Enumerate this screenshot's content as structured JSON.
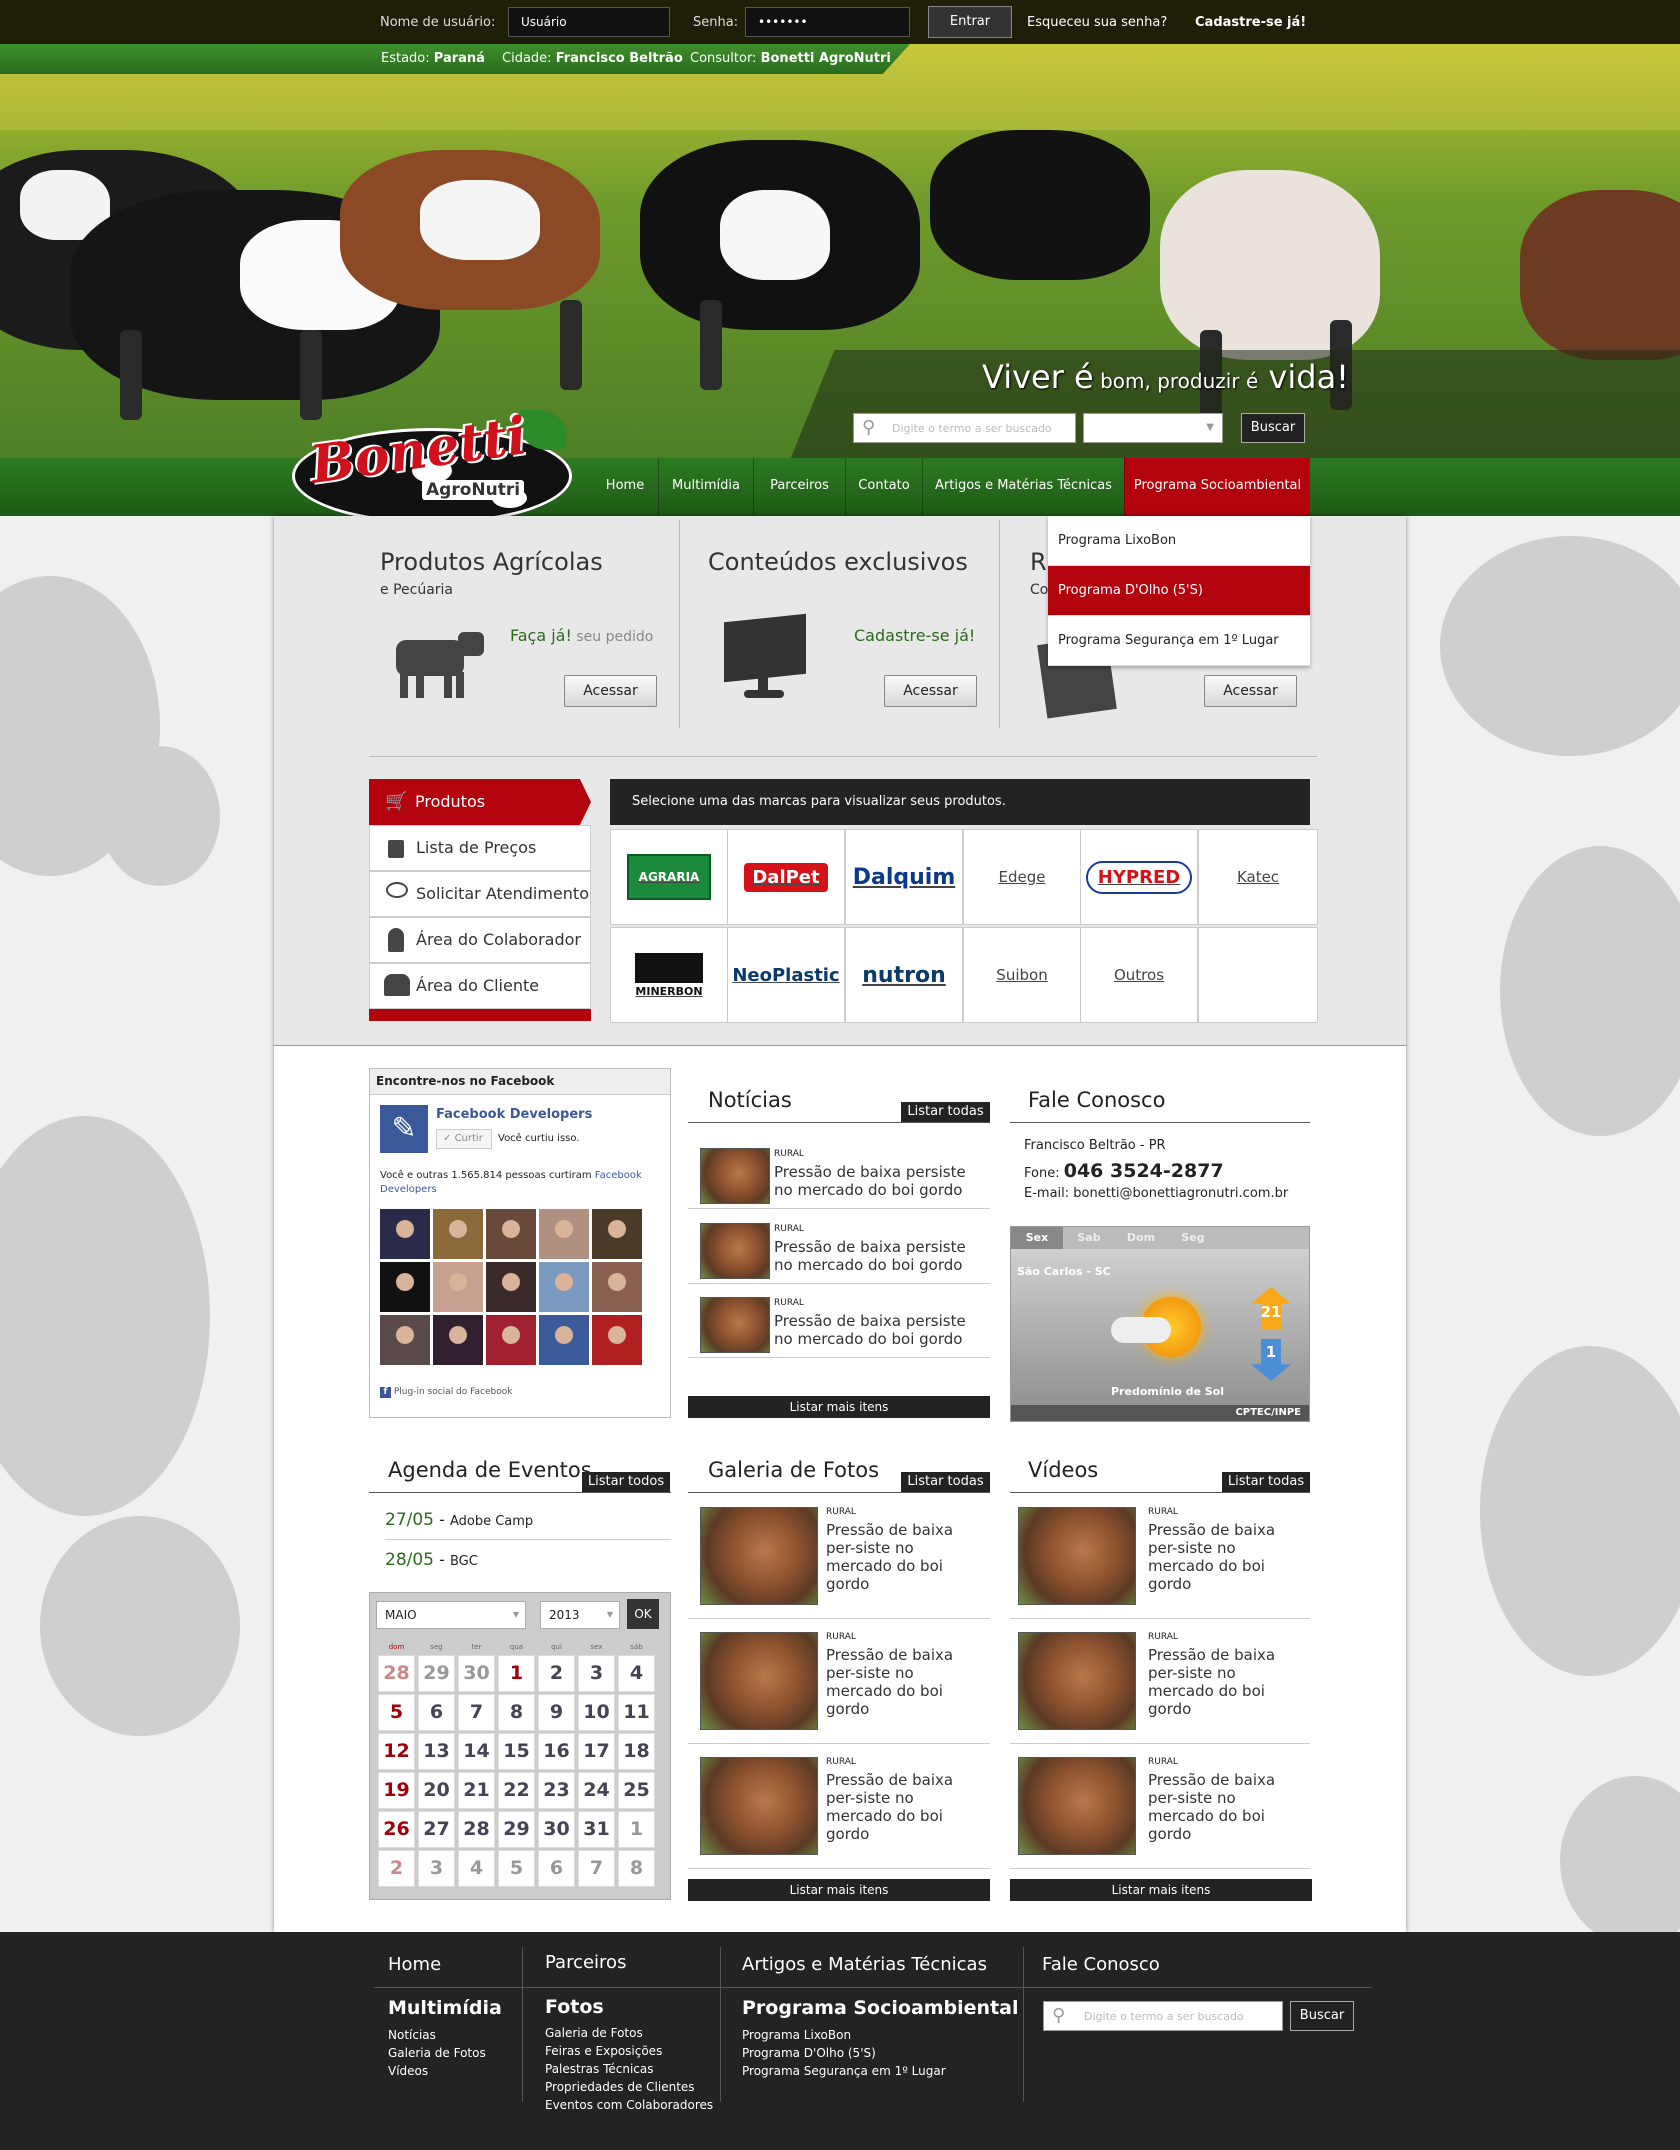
{
  "login": {
    "user_label": "Nome de usuário:",
    "user_value": "Usuário",
    "pass_label": "Senha:",
    "pass_value": "•••••••",
    "enter": "Entrar",
    "forgot": "Esqueceu sua senha?",
    "signup": "Cadastre-se já!"
  },
  "location": {
    "state_label": "Estado:",
    "state": "Paraná",
    "city_label": "Cidade:",
    "city": "Francisco Beltrão",
    "consultant_label": "Consultor:",
    "consultant": "Bonetti AgroNutri"
  },
  "hero": {
    "slogan_a": "Viver ",
    "slogan_b": "é",
    "slogan_c": " bom, produzir ",
    "slogan_d": "é",
    "slogan_e": " vida!",
    "search_placeholder": "Digite o termo a ser buscado",
    "search_button": "Buscar"
  },
  "logo": {
    "name": "Bonetti",
    "sub": "AgroNutri"
  },
  "nav": {
    "items": [
      "Home",
      "Multimídia",
      "Parceiros",
      "Contato",
      "Artigos e Matérias Técnicas",
      "Programa Socioambiental"
    ]
  },
  "dropdown": [
    "Programa LixoBon",
    "Programa D'Olho (5'S)",
    "Programa Segurança em 1º Lugar"
  ],
  "features": [
    {
      "title": "Produtos Agrícolas",
      "sub": "e Pecúaria",
      "cta": "Faça já!",
      "cta2": " seu pedido",
      "button": "Acessar"
    },
    {
      "title": "Conteúdos exclusivos",
      "cta": "Cadastre-se já!",
      "button": "Acessar"
    },
    {
      "title": "R",
      "sub": "Co",
      "button": "Acessar"
    }
  ],
  "side_menu": {
    "items": [
      "Produtos",
      "Lista de Preços",
      "Solicitar Atendimento",
      "Área do Colaborador",
      "Área do Cliente"
    ]
  },
  "brands": {
    "header": "Selecione uma das marcas para visualizar seus produtos.",
    "row1": [
      "AGRARIA",
      "DalPet",
      "Dalquim",
      "Edege",
      "HYPRED",
      "Katec"
    ],
    "row2": [
      "MINERBON",
      "NeoPlastic",
      "nutron",
      "Suibon",
      "Outros",
      ""
    ]
  },
  "facebook": {
    "header": "Encontre-nos no Facebook",
    "page": "Facebook Developers",
    "like": "Curtir",
    "liked": "Você curtiu isso.",
    "count_text": "Você e outras 1.565.814 pessoas curtiram ",
    "count_link": "Facebook Developers",
    "plugin": "Plug-in social do Facebook"
  },
  "news": {
    "title": "Notícias",
    "list_all": "Listar todas",
    "items": [
      {
        "tag": "RURAL",
        "text": "Pressão de baixa persiste no mercado do boi gordo"
      },
      {
        "tag": "RURAL",
        "text": "Pressão de baixa persiste no mercado do boi gordo"
      },
      {
        "tag": "RURAL",
        "text": "Pressão de baixa persiste no mercado do boi gordo"
      }
    ],
    "more": "Listar mais itens"
  },
  "contact": {
    "title": "Fale Conosco",
    "city": "Francisco Beltrão - PR",
    "phone_label": "Fone:",
    "phone": "046 3524-2877",
    "email_label": "E-mail:",
    "email": "bonetti@bonettiagronutri.com.br"
  },
  "weather": {
    "days": [
      "Sex",
      "Sab",
      "Dom",
      "Seg"
    ],
    "place": "São Carlos - SC",
    "max": "21",
    "min": "1",
    "desc": "Predomínio de Sol",
    "source": "CPTEC/INPE"
  },
  "events": {
    "title": "Agenda de Eventos",
    "list_all": "Listar todos",
    "items": [
      {
        "date": "27/05",
        "name": "Adobe Camp"
      },
      {
        "date": "28/05",
        "name": "BGC"
      }
    ]
  },
  "calendar": {
    "month": "MAIO",
    "year": "2013",
    "ok": "OK",
    "weekdays": [
      "dom",
      "seg",
      "ter",
      "qua",
      "qui",
      "sex",
      "sáb"
    ],
    "days": [
      "28",
      "29",
      "30",
      "1",
      "2",
      "3",
      "4",
      "5",
      "6",
      "7",
      "8",
      "9",
      "10",
      "11",
      "12",
      "13",
      "14",
      "15",
      "16",
      "17",
      "18",
      "19",
      "20",
      "21",
      "22",
      "23",
      "24",
      "25",
      "26",
      "27",
      "28",
      "29",
      "30",
      "31",
      "1",
      "2",
      "3",
      "4",
      "5",
      "6",
      "7",
      "8"
    ]
  },
  "gallery": {
    "title": "Galeria de Fotos",
    "list_all": "Listar todas",
    "items": [
      {
        "tag": "RURAL",
        "text": "Pressão de baixa per-siste no mercado do boi gordo"
      },
      {
        "tag": "RURAL",
        "text": "Pressão de baixa per-siste no mercado do boi gordo"
      },
      {
        "tag": "RURAL",
        "text": "Pressão de baixa per-siste no mercado do boi gordo"
      }
    ],
    "more": "Listar mais itens"
  },
  "videos": {
    "title": "Vídeos",
    "list_all": "Listar todas",
    "items": [
      {
        "tag": "RURAL",
        "text": "Pressão de baixa per-siste no mercado do boi gordo"
      },
      {
        "tag": "RURAL",
        "text": "Pressão de baixa per-siste no mercado do boi gordo"
      },
      {
        "tag": "RURAL",
        "text": "Pressão de baixa per-siste no mercado do boi gordo"
      }
    ],
    "more": "Listar mais itens"
  },
  "footer": {
    "home": "Home",
    "parceiros": "Parceiros",
    "artigos": "Artigos e Matérias Técnicas",
    "fale": "Fale Conosco",
    "multimidia": "Multimídia",
    "multimidia_links": [
      "Notícias",
      "Galeria de Fotos",
      "Vídeos"
    ],
    "fotos": "Fotos",
    "fotos_links": [
      "Galeria de Fotos",
      "Feiras e Exposições",
      "Palestras Técnicas",
      "Propriedades de Clientes",
      "Eventos com Colaboradores"
    ],
    "programa": "Programa Socioambiental",
    "programa_links": [
      "Programa LixoBon",
      "Programa D'Olho (5'S)",
      "Programa Segurança em 1º Lugar"
    ],
    "search_placeholder": "Digite o termo a ser buscado",
    "search_button": "Buscar"
  }
}
